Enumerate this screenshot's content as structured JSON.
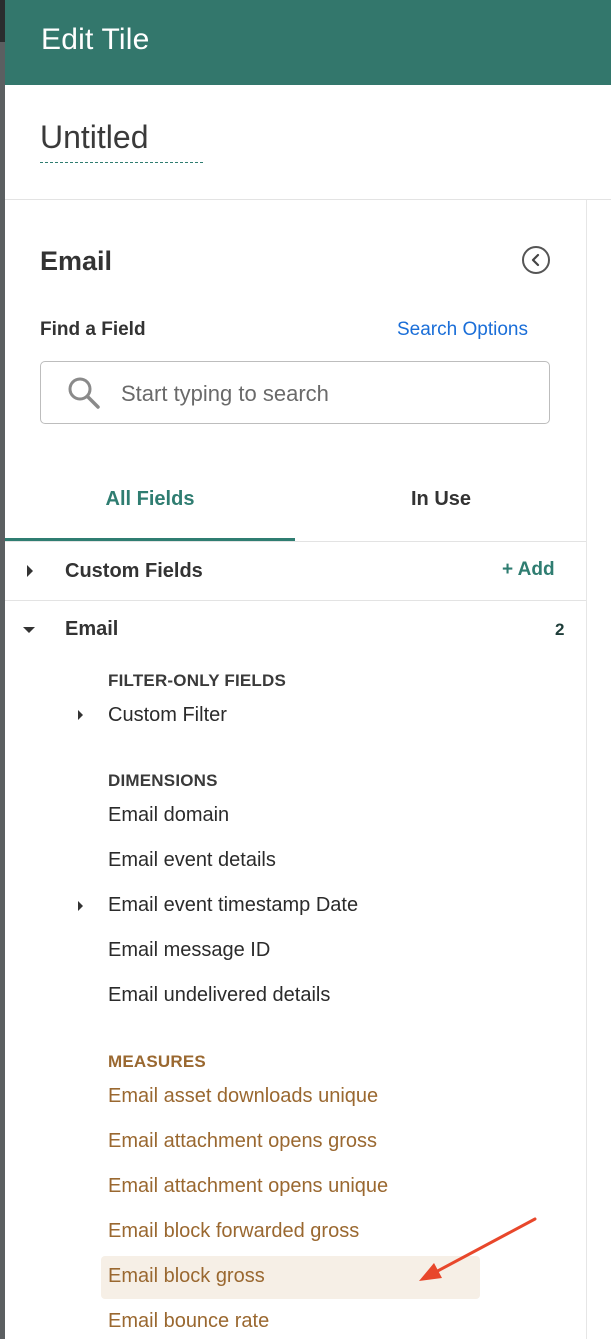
{
  "header": {
    "title": "Edit Tile"
  },
  "tile": {
    "name": "Untitled"
  },
  "panel": {
    "title": "Email",
    "find_label": "Find a Field",
    "search_options_label": "Search Options",
    "search": {
      "placeholder": "Start typing to search",
      "value": ""
    },
    "tabs": [
      {
        "label": "All Fields",
        "active": true
      },
      {
        "label": "In Use",
        "active": false
      }
    ]
  },
  "groups": {
    "custom_fields": {
      "label": "Custom Fields",
      "add_label": "+ Add",
      "expanded": false
    },
    "email": {
      "label": "Email",
      "count": "2",
      "expanded": true,
      "filter_only": {
        "heading": "FILTER-ONLY FIELDS",
        "items": [
          {
            "label": "Custom Filter",
            "expandable": true
          }
        ]
      },
      "dimensions": {
        "heading": "DIMENSIONS",
        "items": [
          {
            "label": "Email domain",
            "expandable": false
          },
          {
            "label": "Email event details",
            "expandable": false
          },
          {
            "label": "Email event timestamp Date",
            "expandable": true
          },
          {
            "label": "Email message ID",
            "expandable": false
          },
          {
            "label": "Email undelivered details",
            "expandable": false
          }
        ]
      },
      "measures": {
        "heading": "MEASURES",
        "items": [
          {
            "label": "Email asset downloads unique",
            "highlighted": false
          },
          {
            "label": "Email attachment opens gross",
            "highlighted": false
          },
          {
            "label": "Email attachment opens unique",
            "highlighted": false
          },
          {
            "label": "Email block forwarded gross",
            "highlighted": false
          },
          {
            "label": "Email block gross",
            "highlighted": true
          },
          {
            "label": "Email bounce rate",
            "highlighted": false
          }
        ]
      }
    }
  },
  "colors": {
    "header_bg": "#33776c",
    "accent": "#2f7d71",
    "link": "#1a6ed8",
    "measure": "#9a6830",
    "highlight_bg": "#f6efe6",
    "annotation_arrow": "#e8472b"
  }
}
